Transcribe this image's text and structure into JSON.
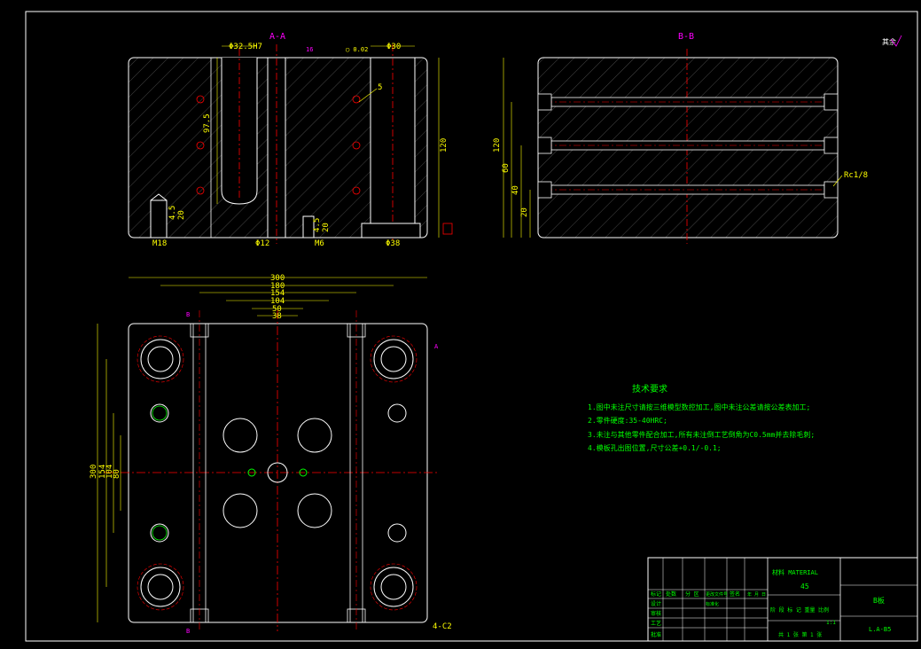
{
  "views": {
    "section_aa": "A-A",
    "section_bb": "B-B"
  },
  "corner_symbol": "其余",
  "dims_aa": {
    "slot_width": "Φ32.5H7",
    "hole_width": "Φ30",
    "depth_left": "97.5",
    "height_right": "120",
    "pin_left": "M18",
    "pin_dim_a": "4.5",
    "pin_dim_b": "20",
    "center_dim": "Φ12",
    "pin_mid": "M6",
    "mid_a": "4.5",
    "mid_b": "20",
    "base_dim": "Φ38",
    "hole_note": "5",
    "roughness_top": "16",
    "tol_frame": "◯ 0.02"
  },
  "dims_bb": {
    "h_total": "120",
    "h_a": "60",
    "h_b": "40",
    "h_c": "20",
    "thread_note": "Rc1/8"
  },
  "dims_plan": {
    "w1": "300",
    "w2": "180",
    "w3": "154",
    "w4": "104",
    "w5": "50",
    "w6": "38",
    "h1": "300",
    "h2": "154",
    "h3": "104",
    "h4": "80",
    "chamfer_note": "4-C2",
    "label_a": "A",
    "label_b": "B"
  },
  "tech_requirements": {
    "title": "技术要求",
    "items": [
      "1.图中未注尺寸请按三维模型数控加工,图中未注公差请按公差表加工;",
      "2.零件硬度:35-40HRC;",
      "3.未注与其他零件配合加工,所有未注倒工艺倒角为C0.5mm并去除毛刺;",
      "4.模板孔出图位置,尺寸公差+0.1/-0.1;"
    ]
  },
  "title_block": {
    "material_label": "材料 MATERIAL",
    "material_value": "45",
    "part_name": "B板",
    "drawing_no": "L.A-B5",
    "scale": "1:1",
    "sheet": "共 1 张    第 1 张",
    "headers": [
      "标记",
      "处数",
      "分 区",
      "更改文件号",
      "签名",
      "年 月 日"
    ],
    "rows": [
      "设计",
      "审核",
      "工艺",
      "标准化",
      "批准"
    ],
    "stage_label": "阶 段 标 记   重量   比例"
  },
  "colors": {
    "outline": "#ffffff",
    "center": "#ff0000",
    "dims": "#ffff00",
    "labels": "#ff00ff",
    "text": "#00ff00",
    "border": "#ffffff"
  }
}
